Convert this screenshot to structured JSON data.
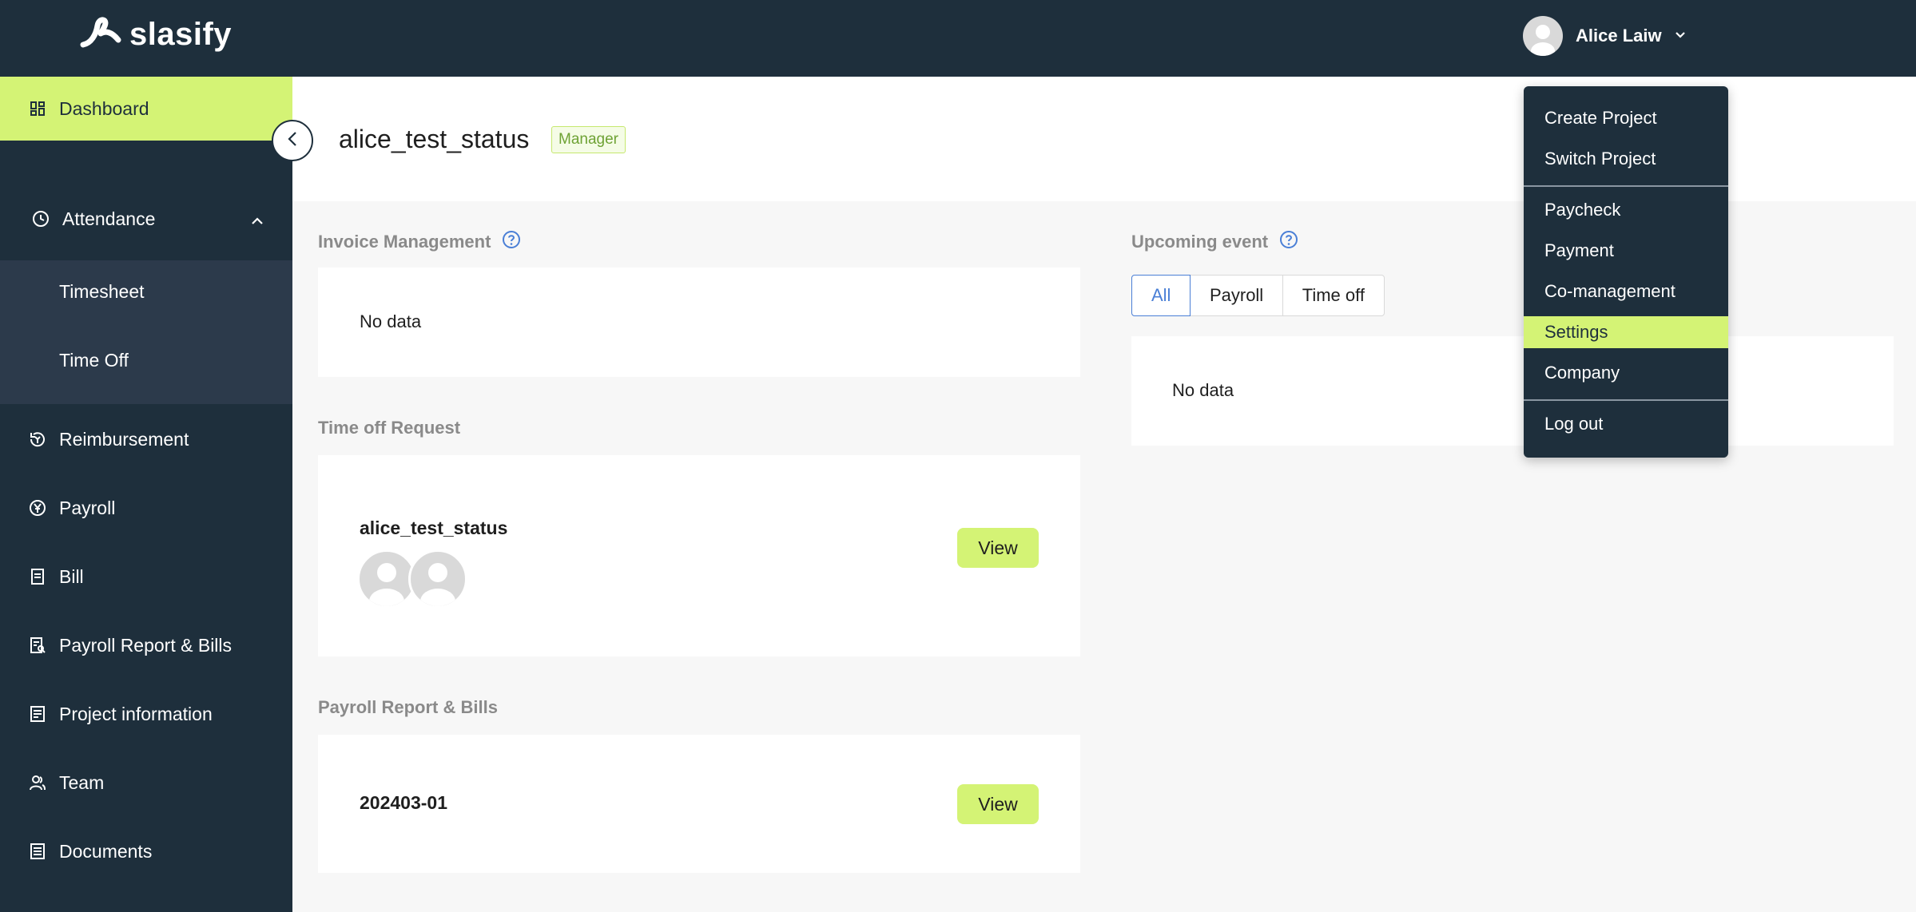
{
  "app": {
    "logo_text": "slasify"
  },
  "user": {
    "name": "Alice Laiw"
  },
  "sidebar": {
    "dashboard": "Dashboard",
    "attendance": "Attendance",
    "timesheet": "Timesheet",
    "time_off": "Time Off",
    "reimbursement": "Reimbursement",
    "payroll": "Payroll",
    "bill": "Bill",
    "payroll_report_bills": "Payroll Report & Bills",
    "project_information": "Project information",
    "team": "Team",
    "documents": "Documents"
  },
  "page": {
    "title": "alice_test_status",
    "role_badge": "Manager"
  },
  "invoice": {
    "title": "Invoice Management",
    "empty": "No data"
  },
  "time_off_request": {
    "title": "Time off Request",
    "name": "alice_test_status",
    "view_label": "View"
  },
  "payroll_report": {
    "title": "Payroll Report & Bills",
    "report_id": "202403-01",
    "view_label": "View"
  },
  "upcoming": {
    "title": "Upcoming event",
    "tabs": [
      "All",
      "Payroll",
      "Time off"
    ],
    "selected_tab": "All",
    "empty": "No data"
  },
  "dropdown": {
    "items": [
      "Create Project",
      "Switch Project",
      "Paycheck",
      "Payment",
      "Co-management",
      "Settings",
      "Company",
      "Log out"
    ],
    "highlighted": "Settings"
  },
  "colors": {
    "nav_bg": "#1e2f3c",
    "accent": "#d4f375",
    "link_blue": "#4a7fd6"
  }
}
